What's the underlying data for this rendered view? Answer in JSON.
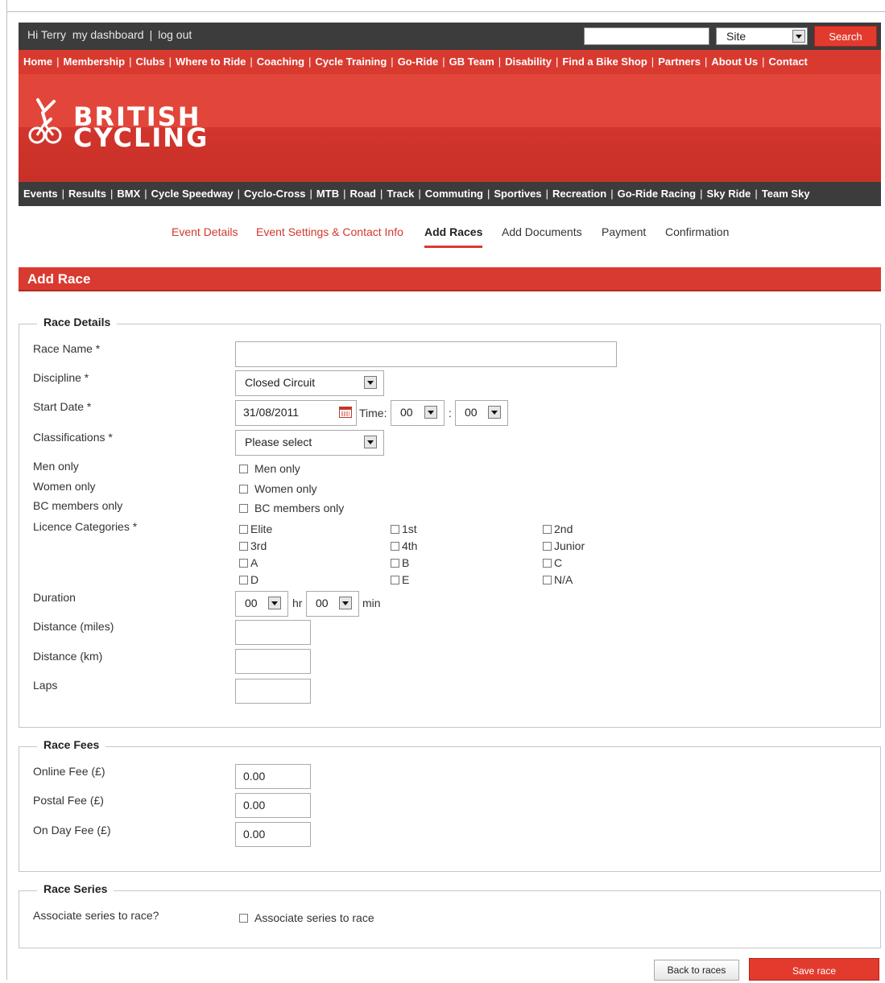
{
  "topbar": {
    "greeting": "Hi Terry",
    "dashboard_link": "my dashboard",
    "separator": "|",
    "logout_link": "log out",
    "search_value": "",
    "search_scope": "Site",
    "search_button": "Search"
  },
  "main_nav": [
    "Home",
    "Membership",
    "Clubs",
    "Where to Ride",
    "Coaching",
    "Cycle Training",
    "Go-Ride",
    "GB Team",
    "Disability",
    "Find a Bike Shop",
    "Partners",
    "About Us",
    "Contact"
  ],
  "logo": {
    "line1": "BRITISH",
    "line2": "CYCLING"
  },
  "sub_nav": [
    "Events",
    "Results",
    "BMX",
    "Cycle Speedway",
    "Cyclo-Cross",
    "MTB",
    "Road",
    "Track",
    "Commuting",
    "Sportives",
    "Recreation",
    "Go-Ride Racing",
    "Sky Ride",
    "Team Sky"
  ],
  "steps": {
    "event_details": "Event Details",
    "event_settings": "Event Settings & Contact Info",
    "add_races": "Add Races",
    "add_documents": "Add Documents",
    "payment": "Payment",
    "confirmation": "Confirmation"
  },
  "section_title": "Add Race",
  "race_details": {
    "legend": "Race Details",
    "race_name_label": "Race Name *",
    "race_name_value": "",
    "discipline_label": "Discipline *",
    "discipline_value": "Closed Circuit",
    "start_date_label": "Start Date *",
    "start_date_value": "31/08/2011",
    "time_label": "Time:",
    "hour_value": "00",
    "time_colon": ":",
    "minute_value": "00",
    "classifications_label": "Classifications *",
    "classifications_value": "Please select",
    "men_only_label": "Men only",
    "men_only_cb": "Men only",
    "women_only_label": "Women only",
    "women_only_cb": "Women only",
    "bc_members_label": "BC members only",
    "bc_members_cb": "BC members only",
    "licence_label": "Licence Categories *",
    "licence_categories": [
      "Elite",
      "1st",
      "2nd",
      "3rd",
      "4th",
      "Junior",
      "A",
      "B",
      "C",
      "D",
      "E",
      "N/A"
    ],
    "duration_label": "Duration",
    "duration_hr_value": "00",
    "hr_unit": "hr",
    "duration_min_value": "00",
    "min_unit": "min",
    "distance_miles_label": "Distance (miles)",
    "distance_km_label": "Distance (km)",
    "laps_label": "Laps"
  },
  "race_fees": {
    "legend": "Race Fees",
    "online_label": "Online Fee (£)",
    "online_value": "0.00",
    "postal_label": "Postal Fee (£)",
    "postal_value": "0.00",
    "onday_label": "On Day Fee (£)",
    "onday_value": "0.00"
  },
  "race_series": {
    "legend": "Race Series",
    "associate_label": "Associate series to race?",
    "associate_cb": "Associate series to race"
  },
  "buttons": {
    "back": "Back to races",
    "save": "Save race"
  },
  "colors": {
    "brand_red": "#d93a30",
    "dark_bar": "#3c3c3c"
  }
}
